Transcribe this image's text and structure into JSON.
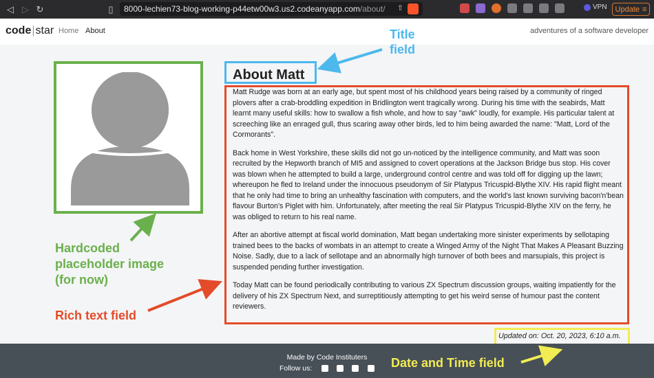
{
  "browser": {
    "url_host": "8000-lechien73-blog-working-p44etw00w3.us2.codeanyapp.com",
    "url_path": "/about/",
    "vpn_label": "VPN",
    "update_label": "Update"
  },
  "navbar": {
    "brand_code": "code",
    "brand_sep": "|",
    "brand_star": "star",
    "home_label": "Home",
    "about_label": "About",
    "tagline": "adventures of a software developer"
  },
  "about": {
    "title": "About Matt",
    "paragraphs": [
      "Matt Rudge was born at an early age, but spent most of his childhood years being raised by a community of ringed plovers after a crab-broddling expedition in Bridlington went tragically wrong. During his time with the seabirds, Matt learnt many useful skills: how to swallow a fish whole, and how to say \"awk\" loudly, for example. His particular talent at screeching like an enraged gull, thus scaring away other birds, led to him being awarded the name: \"Matt, Lord of the Cormorants\".",
      "Back home in West Yorkshire, these skills did not go un-noticed by the intelligence community, and Matt was soon recruited by the Hepworth branch of MI5 and assigned to covert operations at the Jackson Bridge bus stop. His cover was blown when he attempted to build a large, underground control centre and was told off for digging up the lawn; whereupon he fled to Ireland under the innocuous pseudonym of Sir Platypus Tricuspid-Blythe XIV. His rapid flight meant that he only had time to bring an unhealthy fascination with computers, and the world's last known surviving bacon'n'bean flavour Burton's Piglet with him. Unfortunately, after meeting the real Sir Platypus Tricuspid-Blythe XIV on the ferry, he was obliged to return to his real name.",
      "After an abortive attempt at fiscal world domination, Matt began undertaking more sinister experiments by sellotaping trained bees to the backs of wombats in an attempt to create a Winged Army of the Night That Makes A Pleasant Buzzing Noise. Sadly, due to a lack of sellotape and an abnormally high turnover of both bees and marsupials, this project is suspended pending further investigation.",
      "Today Matt can be found periodically contributing to various ZX Spectrum discussion groups, waiting impatiently for the delivery of his ZX Spectrum Next, and surreptitiously attempting to get his weird sense of humour past the content reviewers."
    ],
    "updated": "Updated on: Oct. 20, 2023, 6:10 a.m."
  },
  "annotations": {
    "title_field": [
      "Title",
      "field"
    ],
    "image_field": [
      "Hardcoded",
      "placeholder image",
      "(for now)"
    ],
    "rich_text_field": "Rich text field",
    "date_field": "Date and Time field"
  },
  "footer": {
    "made_by": "Made by Code Instituters",
    "follow_us": "Follow us:"
  },
  "colors": {
    "title_annotation": "#4cb8ec",
    "image_annotation": "#6ab04c",
    "rich_text_annotation": "#e44b2a",
    "date_annotation": "#f1ec52",
    "footer_bg": "#474f57"
  }
}
